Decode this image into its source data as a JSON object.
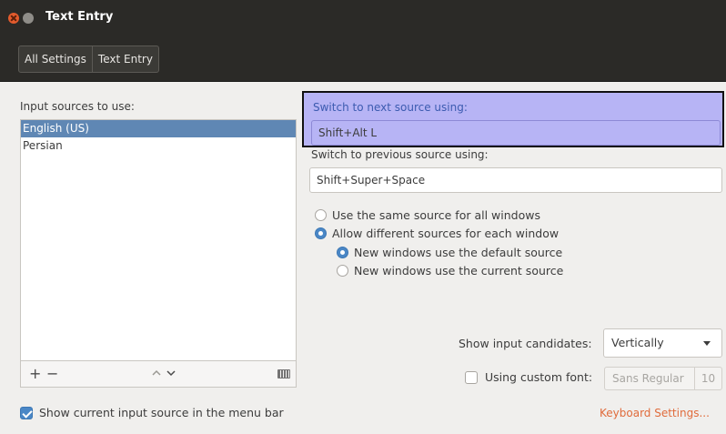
{
  "window": {
    "title": "Text Entry"
  },
  "breadcrumbs": [
    "All Settings",
    "Text Entry"
  ],
  "input_sources": {
    "label": "Input sources to use:",
    "items": [
      "English (US)",
      "Persian"
    ],
    "selected": "English (US)"
  },
  "list_toolbar": {
    "add": "+",
    "remove": "−"
  },
  "show_in_menu_bar": {
    "label": "Show current input source in the menu bar",
    "checked": true
  },
  "switch_next": {
    "label": "Switch to next source using:",
    "value": "Shift+Alt L"
  },
  "switch_prev": {
    "label": "Switch to previous source using:",
    "value": "Shift+Super+Space"
  },
  "radio_options": {
    "same_source": {
      "label": "Use the same source for all windows",
      "selected": false
    },
    "different_sources": {
      "label": "Allow different sources for each window",
      "selected": true
    },
    "default_source": {
      "label": "New windows use the default source",
      "selected": true
    },
    "current_source": {
      "label": "New windows use the current source",
      "selected": false
    }
  },
  "candidates": {
    "label": "Show input candidates:",
    "value": "Vertically"
  },
  "custom_font": {
    "label": "Using custom font:",
    "checked": false,
    "font_name": "Sans Regular",
    "font_size": "10"
  },
  "keyboard_settings_link": "Keyboard Settings...",
  "colors": {
    "accent": "#4a87c6",
    "selection": "#5f87b4",
    "link": "#e06b3b",
    "highlight": "#b7b4f5"
  }
}
